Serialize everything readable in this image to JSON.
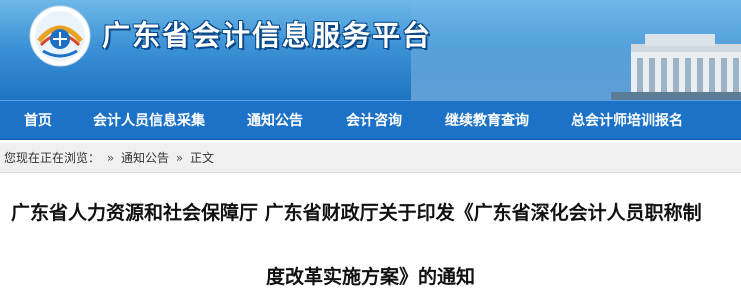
{
  "site": {
    "title": "广东省会计信息服务平台"
  },
  "nav": {
    "items": [
      {
        "label": "首页"
      },
      {
        "label": "会计人员信息采集"
      },
      {
        "label": "通知公告"
      },
      {
        "label": "会计咨询"
      },
      {
        "label": "继续教育查询"
      },
      {
        "label": "总会计师培训报名"
      }
    ]
  },
  "breadcrumb": {
    "prefix": "您现在正在浏览：",
    "separator": "»",
    "items": [
      "通知公告",
      "正文"
    ]
  },
  "article": {
    "title_line1": "广东省人力资源和社会保障厅 广东省财政厅关于印发《广东省深化会计人员职称制",
    "title_line2": "度改革实施方案》的通知"
  },
  "colors": {
    "nav_bg": "#1c72c6",
    "header_bg": "#3d93d6",
    "breadcrumb_bg": "#f0f0f0"
  }
}
